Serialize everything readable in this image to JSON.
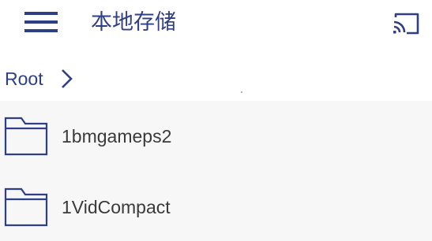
{
  "header": {
    "title": "本地存储",
    "menu_icon": "hamburger-menu-icon",
    "cast_icon": "cast-icon"
  },
  "breadcrumb": {
    "items": [
      "Root"
    ],
    "separator_icon": "chevron-right-icon"
  },
  "files": [
    {
      "name": "1bmgameps2",
      "type": "folder",
      "icon": "folder-icon"
    },
    {
      "name": "1VidCompact",
      "type": "folder",
      "icon": "folder-icon"
    }
  ],
  "colors": {
    "accent": "#2f3f86",
    "list_background": "#f7f7f7",
    "text": "#3a3a3a"
  }
}
